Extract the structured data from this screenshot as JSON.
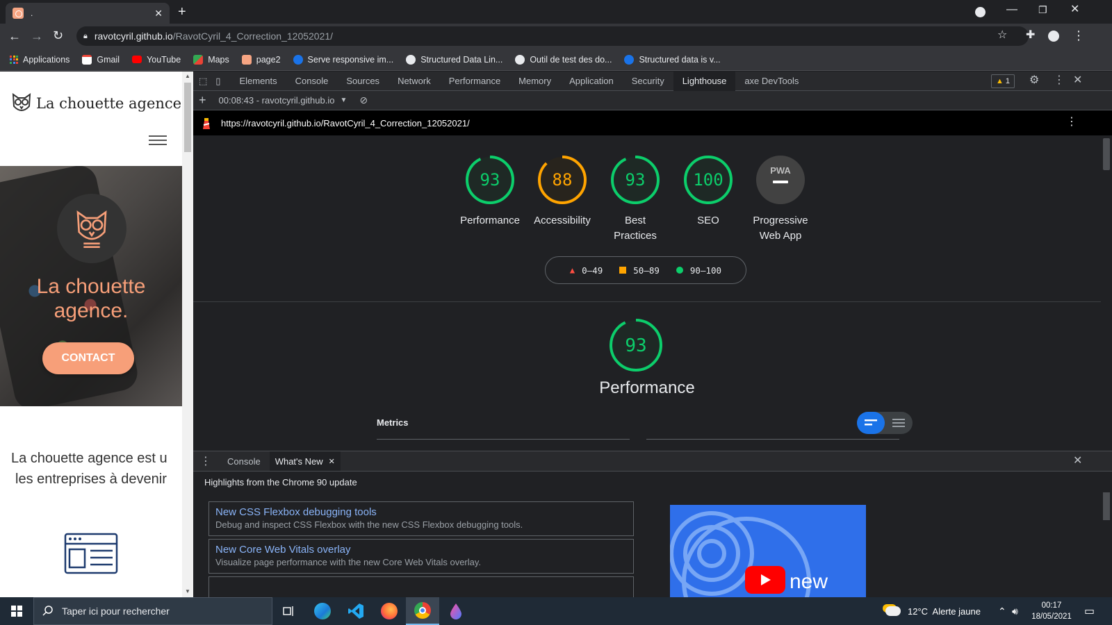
{
  "browser": {
    "tab_title": ".",
    "url_host": "ravotcyril.github.io",
    "url_path": "/RavotCyril_4_Correction_12052021/",
    "bookmarks": [
      {
        "label": "Applications",
        "color": "#ea4335"
      },
      {
        "label": "Gmail",
        "color": "#ea4335"
      },
      {
        "label": "YouTube",
        "color": "#ff0000"
      },
      {
        "label": "Maps",
        "color": "#34a853"
      },
      {
        "label": "page2",
        "color": "#f6a583"
      },
      {
        "label": "Serve responsive im...",
        "color": "#1a73e8"
      },
      {
        "label": "Structured Data Lin...",
        "color": "#e8eaed"
      },
      {
        "label": "Outil de test des do...",
        "color": "#e8eaed"
      },
      {
        "label": "Structured data is v...",
        "color": "#1a73e8"
      }
    ]
  },
  "site": {
    "logo_text": "La chouette agence",
    "hero_line1": "La chouette",
    "hero_line2": "agence.",
    "contact_label": "CONTACT",
    "intro_line1": "La chouette agence est u",
    "intro_line2": "les entreprises à devenir",
    "accent_color": "#f79f79"
  },
  "devtools": {
    "tabs": [
      "Elements",
      "Console",
      "Sources",
      "Network",
      "Performance",
      "Memory",
      "Application",
      "Security",
      "Lighthouse",
      "axe DevTools"
    ],
    "active_tab": "Lighthouse",
    "warning_count": "1",
    "lighthouse_run": "00:08:43 - ravotcyril.github.io",
    "report_url": "https://ravotcyril.github.io/RavotCyril_4_Correction_12052021/",
    "scores": [
      {
        "label_1": "Performance",
        "label_2": "",
        "score": 93,
        "color": "#0cce6b"
      },
      {
        "label_1": "Accessibility",
        "label_2": "",
        "score": 88,
        "color": "#ffa400"
      },
      {
        "label_1": "Best",
        "label_2": "Practices",
        "score": 93,
        "color": "#0cce6b"
      },
      {
        "label_1": "SEO",
        "label_2": "",
        "score": 100,
        "color": "#0cce6b"
      },
      {
        "label_1": "Progressive",
        "label_2": "Web App",
        "badge": "PWA"
      }
    ],
    "legend": [
      "0–49",
      "50–89",
      "90–100"
    ],
    "perf_score": "93",
    "perf_title": "Performance",
    "metrics_label": "Metrics",
    "drawer_tabs": [
      "Console",
      "What's New"
    ],
    "whats_new_heading": "Highlights from the Chrome 90 update",
    "whats_new_items": [
      {
        "title": "New CSS Flexbox debugging tools",
        "desc": "Debug and inspect CSS Flexbox with the new CSS Flexbox debugging tools."
      },
      {
        "title": "New Core Web Vitals overlay",
        "desc": "Visualize page performance with the new Core Web Vitals overlay."
      }
    ],
    "video_text": "new"
  },
  "taskbar": {
    "search_placeholder": "Taper ici pour rechercher",
    "weather": "12°C  Alerte jaune",
    "time": "00:17",
    "date": "18/05/2021"
  }
}
